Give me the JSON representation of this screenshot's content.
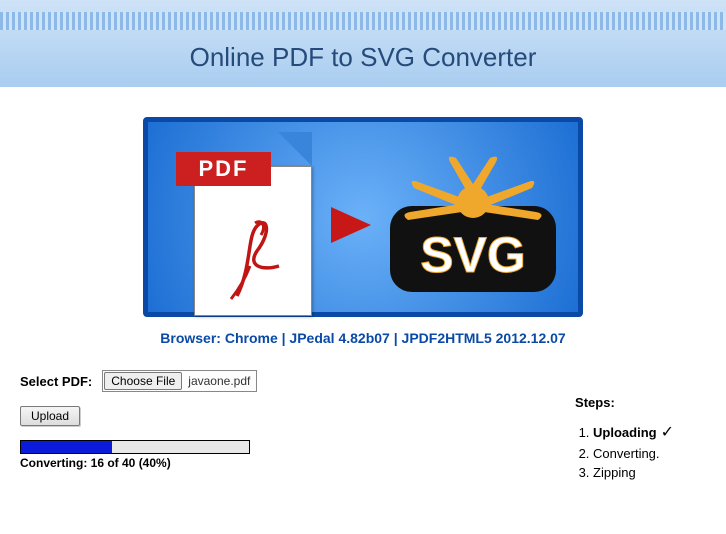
{
  "header": {
    "title": "Online PDF to SVG Converter"
  },
  "hero": {
    "pdf_label": "PDF",
    "svg_label": "SVG"
  },
  "info_line": "Browser: Chrome | JPedal 4.82b07 | JPDF2HTML5 2012.12.07",
  "form": {
    "select_label": "Select PDF:",
    "choose_label": "Choose File",
    "filename": "javaone.pdf",
    "upload_label": "Upload"
  },
  "progress": {
    "current": 16,
    "total": 40,
    "percent": 40,
    "text": "Converting: 16 of 40 (40%)"
  },
  "steps": {
    "title": "Steps:",
    "items": [
      {
        "label": "Uploading",
        "done": true
      },
      {
        "label": "Converting.",
        "done": false
      },
      {
        "label": "Zipping",
        "done": false
      }
    ]
  }
}
